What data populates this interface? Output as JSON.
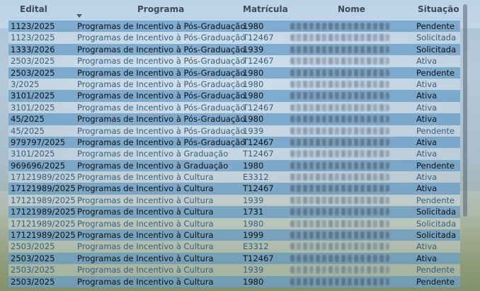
{
  "columns": {
    "edital": "Edital",
    "programa": "Programa",
    "matricula": "Matrícula",
    "nome": "Nome",
    "situacao": "Situação"
  },
  "rows": [
    {
      "edital": "1123/2025",
      "programa": "Programas de Incentivo à Pós-Graduação",
      "matricula": "1980",
      "situacao": "Pendente",
      "style": "dark"
    },
    {
      "edital": "1123/2025",
      "programa": "Programas de Incentivo à Pós-Graduação",
      "matricula": "T12467",
      "situacao": "Solicitada",
      "style": "light"
    },
    {
      "edital": "1333/2026",
      "programa": "Programas de Incentivo à Pós-Graduação",
      "matricula": "1939",
      "situacao": "Solicitada",
      "style": "dark"
    },
    {
      "edital": "2503/2025",
      "programa": "Programas de Incentivo à Pós-Graduação",
      "matricula": "T12467",
      "situacao": "Ativa",
      "style": "light"
    },
    {
      "edital": "2503/2025",
      "programa": "Programas de Incentivo à Pós-Graduação",
      "matricula": "1980",
      "situacao": "Pendente",
      "style": "dark"
    },
    {
      "edital": "3/2025",
      "programa": "Programas de Incentivo à Pós-Graduação",
      "matricula": "1980",
      "situacao": "Ativa",
      "style": "light"
    },
    {
      "edital": "3101/2025",
      "programa": "Programas de Incentivo à Pós-Graduação",
      "matricula": "1980",
      "situacao": "Ativa",
      "style": "dark"
    },
    {
      "edital": "3101/2025",
      "programa": "Programas de Incentivo à Pós-Graduação",
      "matricula": "T12467",
      "situacao": "Ativa",
      "style": "light"
    },
    {
      "edital": "45/2025",
      "programa": "Programas de Incentivo à Pós-Graduação",
      "matricula": "1980",
      "situacao": "Ativa",
      "style": "dark"
    },
    {
      "edital": "45/2025",
      "programa": "Programas de Incentivo à Pós-Graduação",
      "matricula": "1939",
      "situacao": "Pendente",
      "style": "light"
    },
    {
      "edital": "979797/2025",
      "programa": "Programas de Incentivo à Pós-Graduação",
      "matricula": "T12467",
      "situacao": "Ativa",
      "style": "dark"
    },
    {
      "edital": "3101/2025",
      "programa": "Programas de Incentivo à Graduação",
      "matricula": "T12467",
      "situacao": "Ativa",
      "style": "light"
    },
    {
      "edital": "969696/2025",
      "programa": "Programas de Incentivo à Graduação",
      "matricula": "1980",
      "situacao": "Pendente",
      "style": "dark"
    },
    {
      "edital": "17121989/2025",
      "programa": "Programas de Incentivo à Cultura",
      "matricula": "E3312",
      "situacao": "Ativa",
      "style": "light"
    },
    {
      "edital": "17121989/2025",
      "programa": "Programas de Incentivo à Cultura",
      "matricula": "T12467",
      "situacao": "Ativa",
      "style": "dark"
    },
    {
      "edital": "17121989/2025",
      "programa": "Programas de Incentivo à Cultura",
      "matricula": "1939",
      "situacao": "Pendente",
      "style": "light"
    },
    {
      "edital": "17121989/2025",
      "programa": "Programas de Incentivo à Cultura",
      "matricula": "1731",
      "situacao": "Solicitada",
      "style": "dark"
    },
    {
      "edital": "17121989/2025",
      "programa": "Programas de Incentivo à Cultura",
      "matricula": "1980",
      "situacao": "Solicitada",
      "style": "light"
    },
    {
      "edital": "17121989/2025",
      "programa": "Programas de Incentivo à Cultura",
      "matricula": "1999",
      "situacao": "Solicitada",
      "style": "dark"
    },
    {
      "edital": "2503/2025",
      "programa": "Programas de Incentivo à Cultura",
      "matricula": "E3312",
      "situacao": "Ativa",
      "style": "light"
    },
    {
      "edital": "2503/2025",
      "programa": "Programas de Incentivo à Cultura",
      "matricula": "T12467",
      "situacao": "Ativa",
      "style": "dark"
    },
    {
      "edital": "2503/2025",
      "programa": "Programas de Incentivo à Cultura",
      "matricula": "1939",
      "situacao": "Pendente",
      "style": "light"
    },
    {
      "edital": "2503/2025",
      "programa": "Programas de Incentivo à Cultura",
      "matricula": "1980",
      "situacao": "Pendente",
      "style": "dark"
    }
  ]
}
